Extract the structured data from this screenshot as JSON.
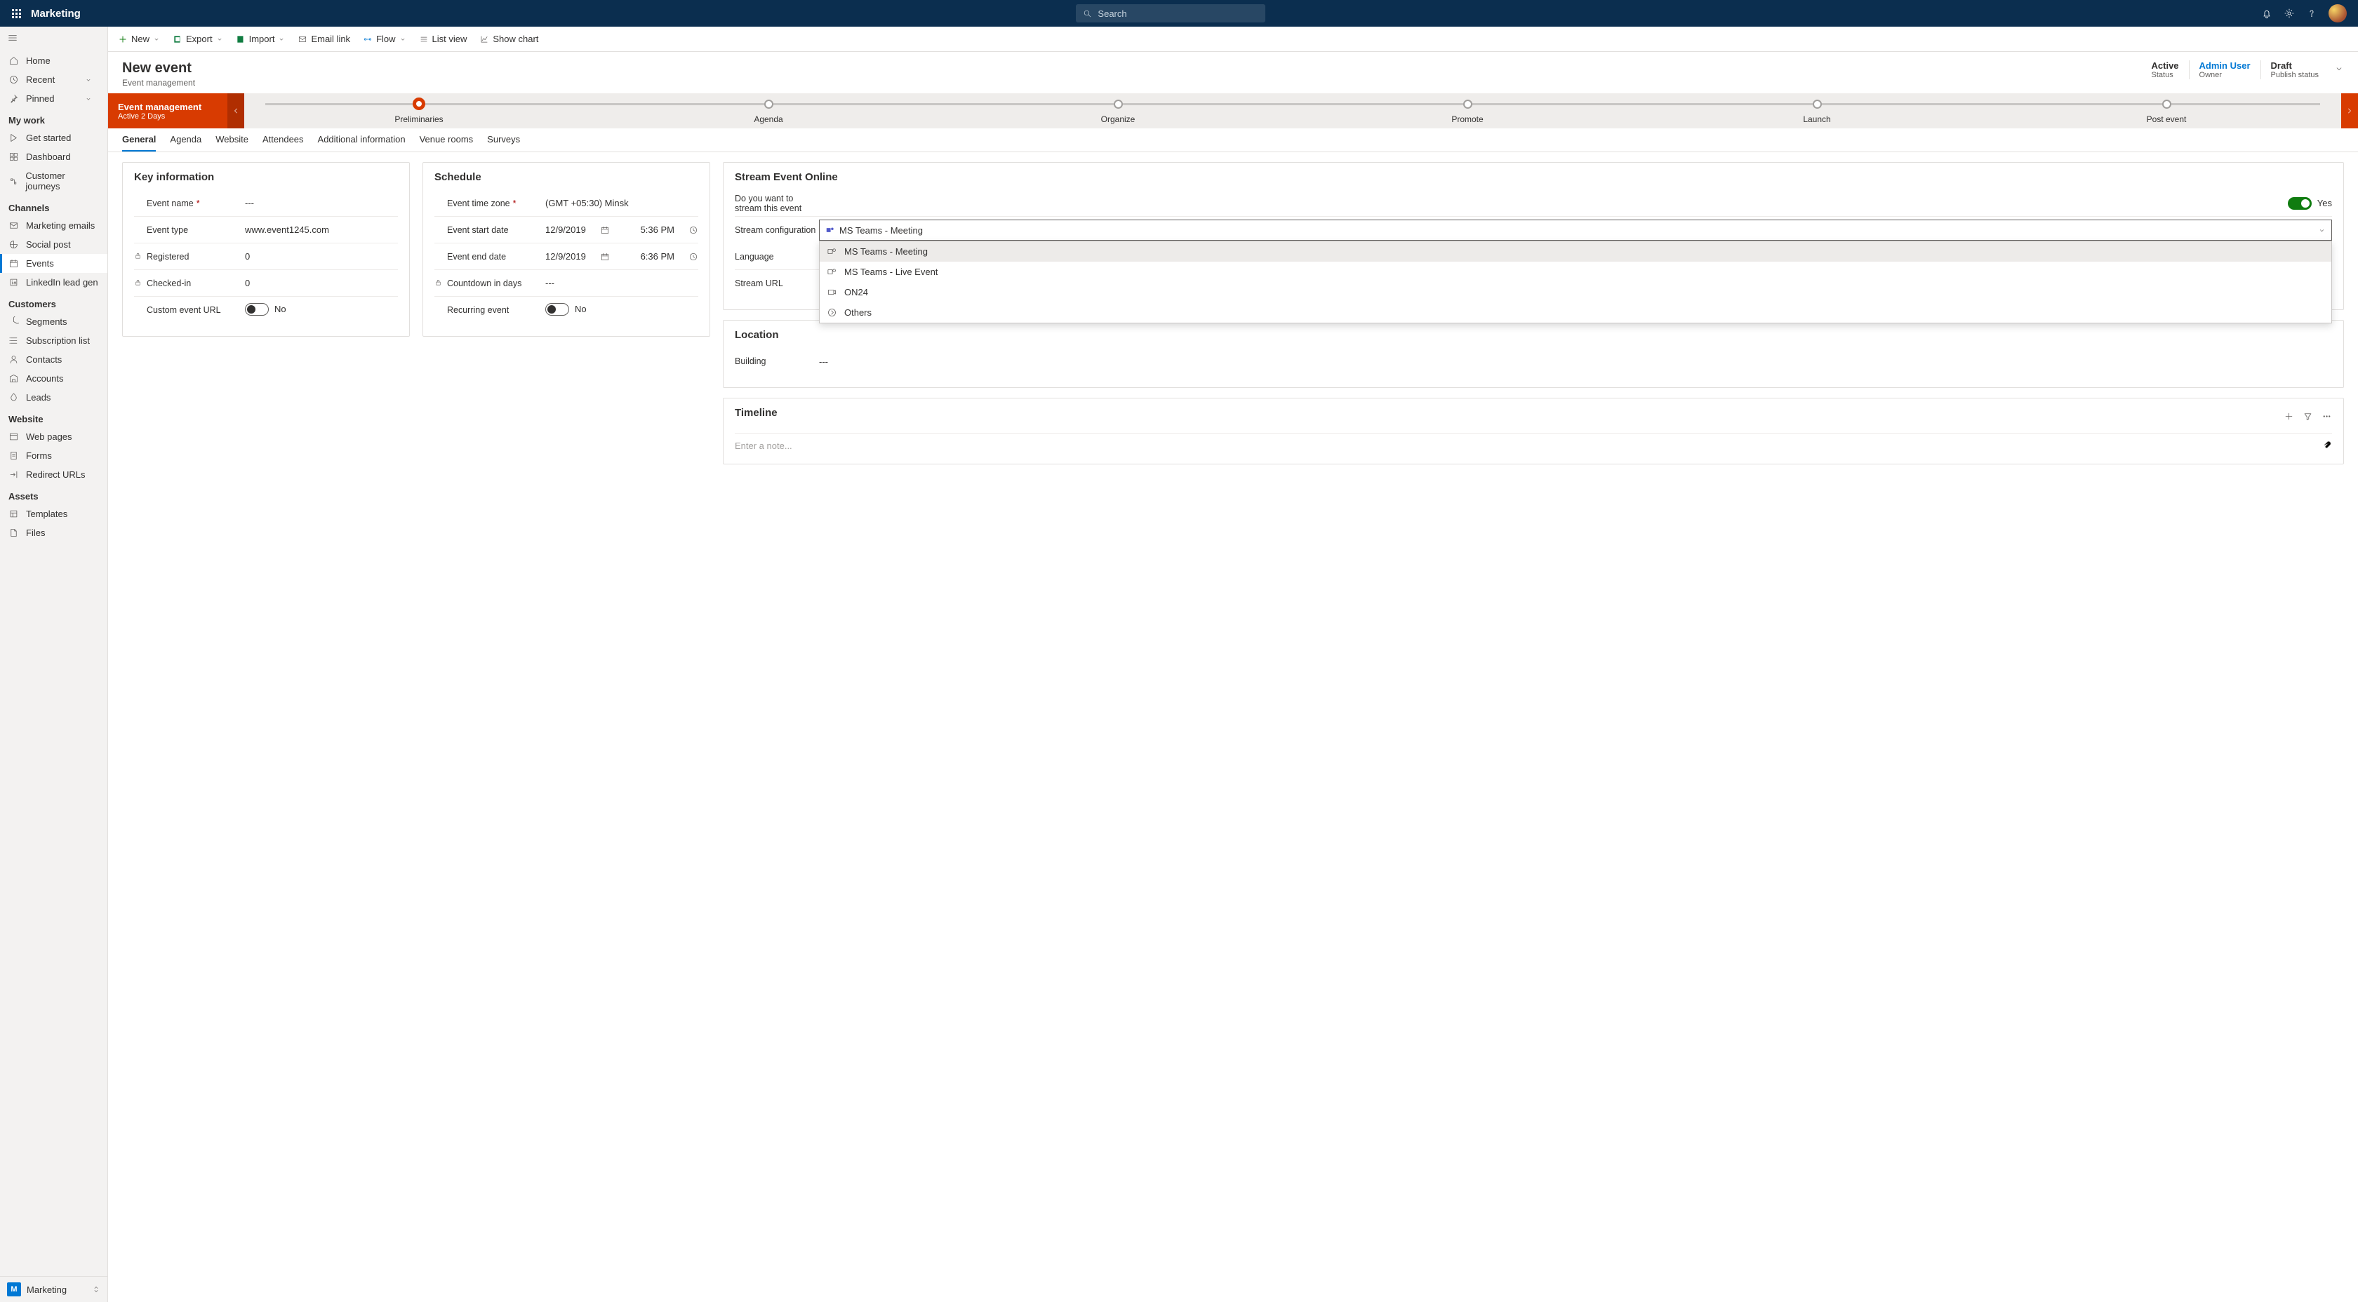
{
  "app_name": "Marketing",
  "search_placeholder": "Search",
  "command_bar": {
    "new": "New",
    "export": "Export",
    "import": "Import",
    "email_link": "Email link",
    "flow": "Flow",
    "list_view": "List view",
    "show_chart": "Show chart"
  },
  "sidebar": {
    "top": {
      "home": "Home",
      "recent": "Recent",
      "pinned": "Pinned"
    },
    "groups": [
      {
        "title": "My work",
        "items": [
          "Get started",
          "Dashboard",
          "Customer journeys"
        ]
      },
      {
        "title": "Channels",
        "items": [
          "Marketing emails",
          "Social post",
          "Events",
          "LinkedIn lead gen"
        ],
        "active": "Events"
      },
      {
        "title": "Customers",
        "items": [
          "Segments",
          "Subscription list",
          "Contacts",
          "Accounts",
          "Leads"
        ]
      },
      {
        "title": "Website",
        "items": [
          "Web pages",
          "Forms",
          "Redirect URLs"
        ]
      },
      {
        "title": "Assets",
        "items": [
          "Templates",
          "Files"
        ]
      }
    ],
    "area_badge": "M",
    "area_name": "Marketing"
  },
  "header": {
    "title": "New event",
    "subtitle": "Event management",
    "status_value": "Active",
    "status_label": "Status",
    "owner_value": "Admin User",
    "owner_label": "Owner",
    "publish_value": "Draft",
    "publish_label": "Publish status"
  },
  "process": {
    "banner_title": "Event management",
    "banner_sub": "Active 2 Days",
    "stages": [
      "Preliminaries",
      "Agenda",
      "Organize",
      "Promote",
      "Launch",
      "Post event"
    ],
    "current": "Preliminaries"
  },
  "tabs": [
    "General",
    "Agenda",
    "Website",
    "Attendees",
    "Additional information",
    "Venue rooms",
    "Surveys"
  ],
  "active_tab": "General",
  "key_info": {
    "heading": "Key information",
    "event_name_label": "Event name",
    "event_name_value": "---",
    "event_type_label": "Event type",
    "event_type_value": "www.event1245.com",
    "registered_label": "Registered",
    "registered_value": "0",
    "checked_in_label": "Checked-in",
    "checked_in_value": "0",
    "custom_url_label": "Custom event URL",
    "custom_url_value": "No"
  },
  "schedule": {
    "heading": "Schedule",
    "tz_label": "Event time zone",
    "tz_value": "(GMT +05:30) Minsk",
    "start_label": "Event start date",
    "start_date": "12/9/2019",
    "start_time": "5:36 PM",
    "end_label": "Event end date",
    "end_date": "12/9/2019",
    "end_time": "6:36 PM",
    "countdown_label": "Countdown in days",
    "countdown_value": "---",
    "recurring_label": "Recurring event",
    "recurring_value": "No"
  },
  "stream": {
    "heading": "Stream Event Online",
    "question_label": "Do you want to stream this event",
    "question_value": "Yes",
    "config_label": "Stream configuration",
    "config_value": "MS Teams - Meeting",
    "options": [
      "MS Teams - Meeting",
      "MS Teams - Live Event",
      "ON24",
      "Others"
    ],
    "language_label": "Language",
    "url_label": "Stream URL"
  },
  "location": {
    "heading": "Location",
    "building_label": "Building",
    "building_value": "---"
  },
  "timeline": {
    "heading": "Timeline",
    "note_placeholder": "Enter a note..."
  }
}
